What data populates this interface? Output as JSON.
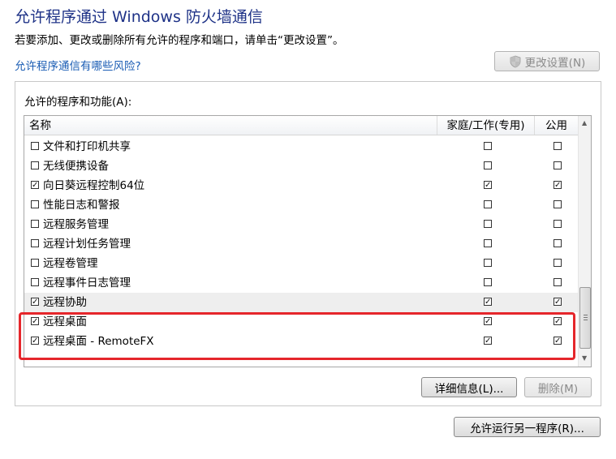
{
  "window_title": "允许程序通过 Windows 防火墙通信",
  "description": "若要添加、更改或删除所有允许的程序和端口，请单击“更改设置”。",
  "risk_link": "允许程序通信有哪些风险?",
  "change_settings_button": "更改设置(N)",
  "group_label": "允许的程序和功能(A):",
  "columns": {
    "name": "名称",
    "home_work": "家庭/工作(专用)",
    "public": "公用"
  },
  "rows": [
    {
      "name": "文件和打印机共享",
      "enabled": false,
      "home": false,
      "public": false
    },
    {
      "name": "无线便携设备",
      "enabled": false,
      "home": false,
      "public": false
    },
    {
      "name": "向日葵远程控制64位",
      "enabled": true,
      "home": true,
      "public": true
    },
    {
      "name": "性能日志和警报",
      "enabled": false,
      "home": false,
      "public": false
    },
    {
      "name": "远程服务管理",
      "enabled": false,
      "home": false,
      "public": false
    },
    {
      "name": "远程计划任务管理",
      "enabled": false,
      "home": false,
      "public": false
    },
    {
      "name": "远程卷管理",
      "enabled": false,
      "home": false,
      "public": false
    },
    {
      "name": "远程事件日志管理",
      "enabled": false,
      "home": false,
      "public": false
    },
    {
      "name": "远程协助",
      "enabled": true,
      "home": true,
      "public": true,
      "selected": true
    },
    {
      "name": "远程桌面",
      "enabled": true,
      "home": true,
      "public": true
    },
    {
      "name": "远程桌面 - RemoteFX",
      "enabled": true,
      "home": true,
      "public": true
    }
  ],
  "details_button": "详细信息(L)...",
  "delete_button": "删除(M)",
  "allow_another_button": "允许运行另一程序(R)...",
  "colors": {
    "title": "#1e3287",
    "link": "#1a5cb4",
    "highlight": "#e5262b",
    "selected_row": "#eeeeee"
  }
}
